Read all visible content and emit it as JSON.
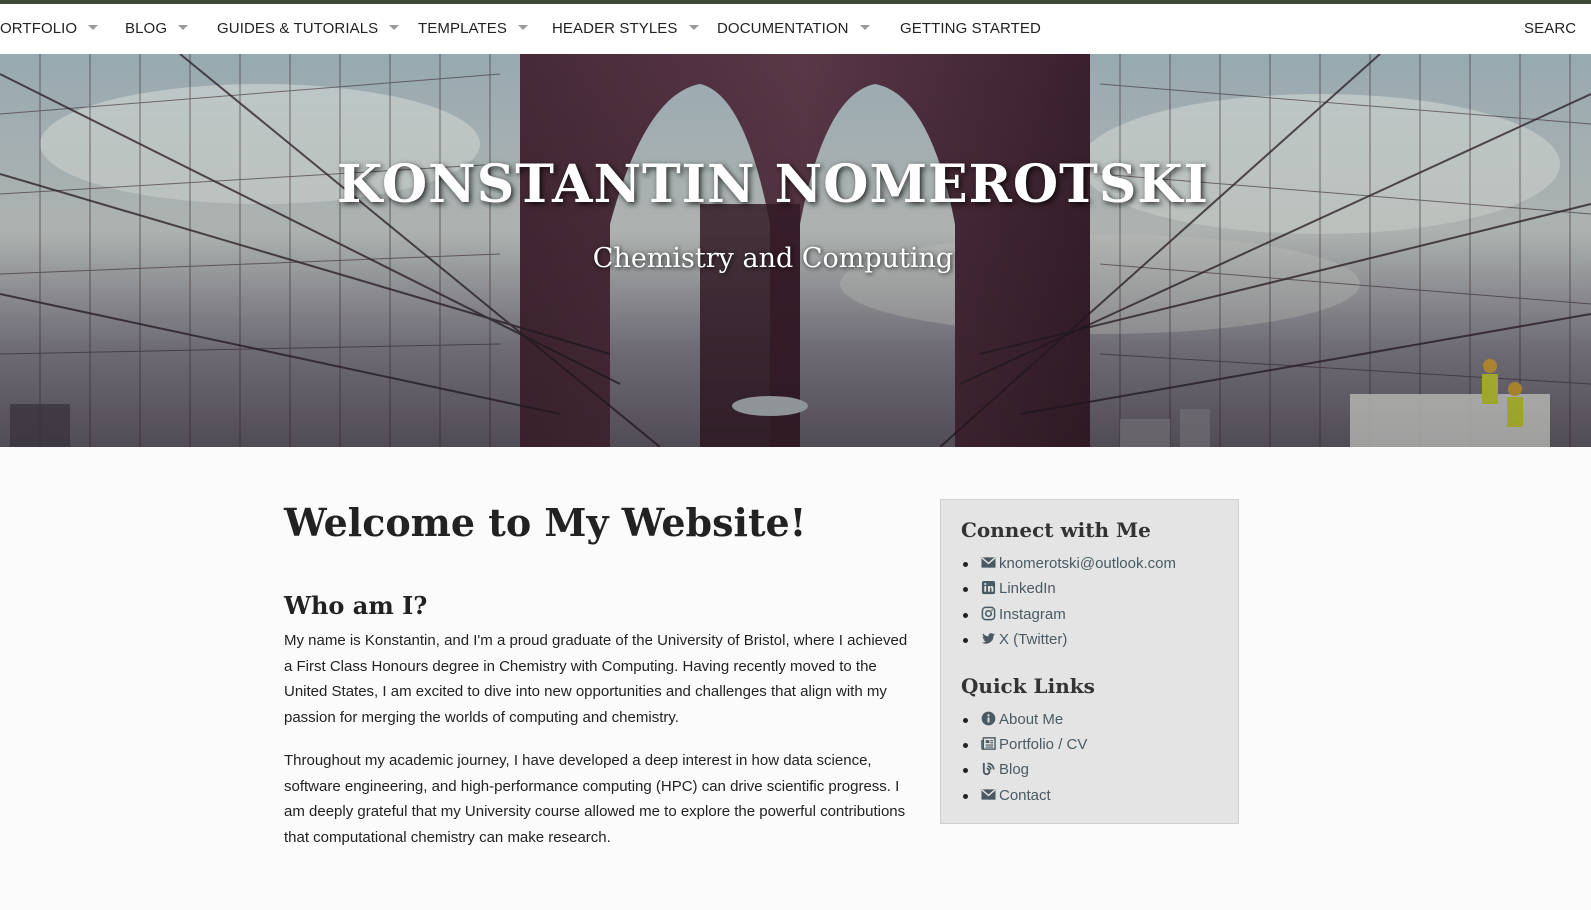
{
  "nav": {
    "items": [
      {
        "label": "ORTFOLIO",
        "dropdown": true
      },
      {
        "label": "BLOG",
        "dropdown": true
      },
      {
        "label": "GUIDES & TUTORIALS",
        "dropdown": true
      },
      {
        "label": "TEMPLATES",
        "dropdown": true
      },
      {
        "label": "HEADER STYLES",
        "dropdown": true
      },
      {
        "label": "DOCUMENTATION",
        "dropdown": true
      },
      {
        "label": "GETTING STARTED",
        "dropdown": false
      }
    ],
    "search_label": "SEARC"
  },
  "hero": {
    "title": "KONSTANTIN NOMEROTSKI",
    "subtitle": "Chemistry and Computing"
  },
  "main": {
    "title": "Welcome to My Website!",
    "section_title": "Who am I?",
    "paragraphs": [
      "My name is Konstantin, and I'm a proud graduate of the University of Bristol, where I achieved a First Class Honours degree in Chemistry with Computing. Having recently moved to the United States, I am excited to dive into new opportunities and challenges that align with my passion for merging the worlds of computing and chemistry.",
      "Throughout my academic journey, I have developed a deep interest in how data science, software engineering, and high-performance computing (HPC) can drive scientific progress. I am deeply grateful that my University course allowed me to explore the powerful contribu­tions that computational chemistry can make research."
    ]
  },
  "sidebar": {
    "connect_title": "Connect with Me",
    "connect_links": [
      {
        "label": "knomerotski@outlook.com",
        "icon": "envelope-icon"
      },
      {
        "label": "LinkedIn",
        "icon": "linkedin-icon"
      },
      {
        "label": "Instagram",
        "icon": "instagram-icon"
      },
      {
        "label": "X (Twitter)",
        "icon": "twitter-icon"
      }
    ],
    "quick_title": "Quick Links",
    "quick_links": [
      {
        "label": "About Me",
        "icon": "info-circle-icon"
      },
      {
        "label": "Portfolio / CV",
        "icon": "newspaper-icon"
      },
      {
        "label": "Blog",
        "icon": "blog-icon"
      },
      {
        "label": "Contact",
        "icon": "envelope-icon"
      }
    ]
  },
  "colors": {
    "accent_bar": "#3e4a38",
    "link": "#4a5a63",
    "sidebar_bg": "#e4e4e4"
  }
}
